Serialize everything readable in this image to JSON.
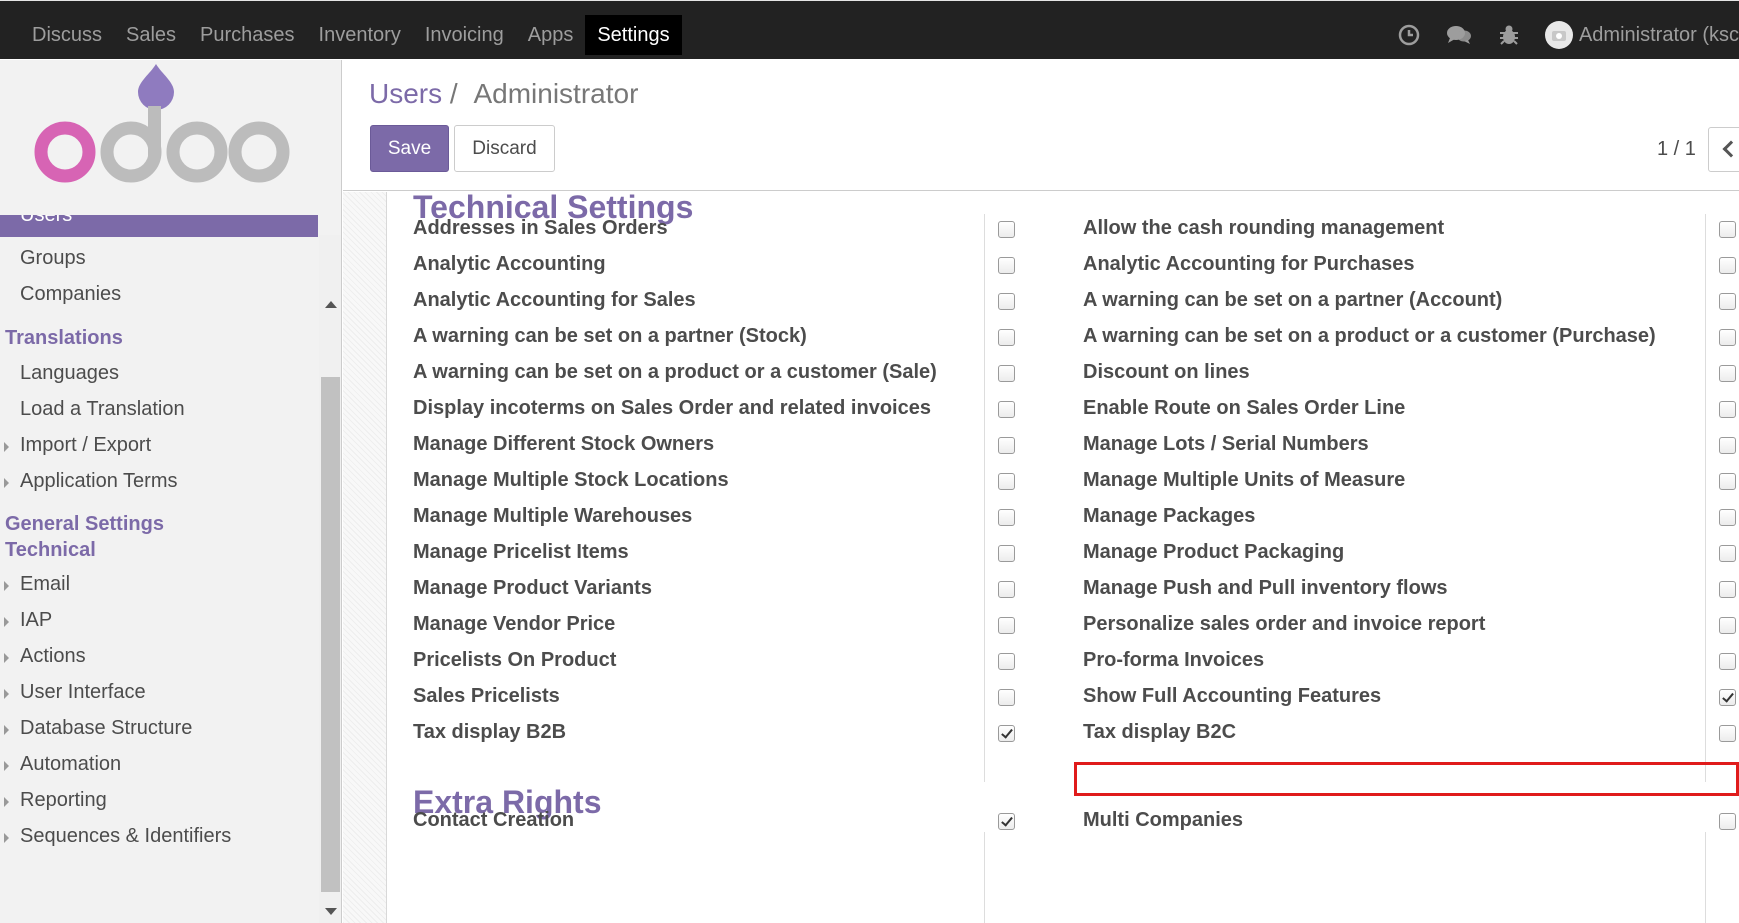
{
  "navbar": {
    "menu": [
      "Discuss",
      "Sales",
      "Purchases",
      "Inventory",
      "Invoicing",
      "Apps",
      "Settings"
    ],
    "active_menu": "Settings",
    "user": "Administrator (ksc"
  },
  "sidebar": {
    "active_item": "Users",
    "items": [
      {
        "type": "item",
        "label": "Groups"
      },
      {
        "type": "item",
        "label": "Companies"
      },
      {
        "type": "header",
        "label": "Translations"
      },
      {
        "type": "item",
        "label": "Languages"
      },
      {
        "type": "item",
        "label": "Load a Translation"
      },
      {
        "type": "caret",
        "label": "Import / Export"
      },
      {
        "type": "caret",
        "label": "Application Terms"
      },
      {
        "type": "header",
        "label": "General Settings"
      },
      {
        "type": "header",
        "label": "Technical"
      },
      {
        "type": "caret",
        "label": "Email"
      },
      {
        "type": "caret",
        "label": "IAP"
      },
      {
        "type": "caret",
        "label": "Actions"
      },
      {
        "type": "caret",
        "label": "User Interface"
      },
      {
        "type": "caret",
        "label": "Database Structure"
      },
      {
        "type": "caret",
        "label": "Automation"
      },
      {
        "type": "caret",
        "label": "Reporting"
      },
      {
        "type": "caret",
        "label": "Sequences & Identifiers"
      }
    ]
  },
  "breadcrumb": {
    "parent": "Users",
    "separator": "/",
    "current": "Administrator"
  },
  "buttons": {
    "save": "Save",
    "discard": "Discard"
  },
  "pager": "1 / 1",
  "technical_settings": {
    "title": "Technical Settings",
    "rows": [
      {
        "left": "Addresses in Sales Orders",
        "left_checked": false,
        "right": "Allow the cash rounding management",
        "right_checked": false
      },
      {
        "left": "Analytic Accounting",
        "left_checked": false,
        "right": "Analytic Accounting for Purchases",
        "right_checked": false
      },
      {
        "left": "Analytic Accounting for Sales",
        "left_checked": false,
        "right": "A warning can be set on a partner (Account)",
        "right_checked": false
      },
      {
        "left": "A warning can be set on a partner (Stock)",
        "left_checked": false,
        "right": "A warning can be set on a product or a customer (Purchase)",
        "right_checked": false
      },
      {
        "left": "A warning can be set on a product or a customer (Sale)",
        "left_checked": false,
        "right": "Discount on lines",
        "right_checked": false
      },
      {
        "left": "Display incoterms on Sales Order and related invoices",
        "left_checked": false,
        "right": "Enable Route on Sales Order Line",
        "right_checked": false
      },
      {
        "left": "Manage Different Stock Owners",
        "left_checked": false,
        "right": "Manage Lots / Serial Numbers",
        "right_checked": false
      },
      {
        "left": "Manage Multiple Stock Locations",
        "left_checked": false,
        "right": "Manage Multiple Units of Measure",
        "right_checked": false
      },
      {
        "left": "Manage Multiple Warehouses",
        "left_checked": false,
        "right": "Manage Packages",
        "right_checked": false
      },
      {
        "left": "Manage Pricelist Items",
        "left_checked": false,
        "right": "Manage Product Packaging",
        "right_checked": false
      },
      {
        "left": "Manage Product Variants",
        "left_checked": false,
        "right": "Manage Push and Pull inventory flows",
        "right_checked": false
      },
      {
        "left": "Manage Vendor Price",
        "left_checked": false,
        "right": "Personalize sales order and invoice report",
        "right_checked": false
      },
      {
        "left": "Pricelists On Product",
        "left_checked": false,
        "right": "Pro-forma Invoices",
        "right_checked": false
      },
      {
        "left": "Sales Pricelists",
        "left_checked": false,
        "right": "Show Full Accounting Features",
        "right_checked": true
      },
      {
        "left": "Tax display B2B",
        "left_checked": true,
        "right": "Tax display B2C",
        "right_checked": false
      }
    ]
  },
  "extra_rights": {
    "title": "Extra Rights",
    "rows": [
      {
        "left": "Contact Creation",
        "left_checked": true,
        "right": "Multi Companies",
        "right_checked": false
      }
    ]
  },
  "colors": {
    "brand": "#7c6aa8",
    "navbar": "#222222",
    "highlight": "#e01b1b"
  }
}
